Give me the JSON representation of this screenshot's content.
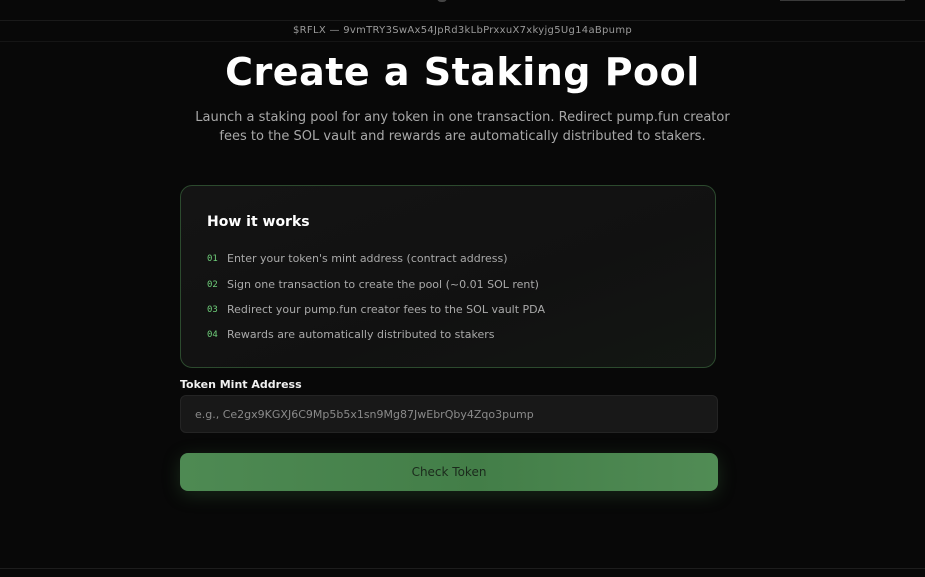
{
  "ticker": {
    "text": "$RFLX — 9vmTRY3SwAx54JpRd3kLbPrxxuX7xkyjg5Ug14aBpump"
  },
  "hero": {
    "title": "Create a Staking Pool",
    "subtitle": "Launch a staking pool for any token in one transaction. Redirect pump.fun creator fees to the SOL vault and rewards are automatically distributed to stakers."
  },
  "how_it_works": {
    "title": "How it works",
    "steps": [
      {
        "num": "01",
        "text": "Enter your token's mint address (contract address)"
      },
      {
        "num": "02",
        "text": "Sign one transaction to create the pool (~0.01 SOL rent)"
      },
      {
        "num": "03",
        "text": "Redirect your pump.fun creator fees to the SOL vault PDA"
      },
      {
        "num": "04",
        "text": "Rewards are automatically distributed to stakers"
      }
    ]
  },
  "form": {
    "label": "Token Mint Address",
    "value": "",
    "placeholder": "e.g., Ce2gx9KGXJ6C9Mp5b5x1sn9Mg87JwEbrQby4Zqo3pump",
    "button_label": "Check Token"
  },
  "colors": {
    "accent": "#4e8a53",
    "step_number": "#6fcf7a",
    "card_border": "#2c4a2e",
    "background": "#080808"
  }
}
